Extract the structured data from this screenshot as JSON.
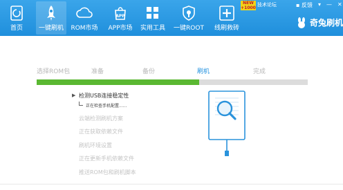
{
  "nav": {
    "home": "首页",
    "one_key_flash": "一键刷机",
    "rom_market": "ROM市场",
    "app_market": "APP市场",
    "tools": "实用工具",
    "one_key_root": "一键ROOT",
    "line_rescue": "线刷救砖"
  },
  "top_right": {
    "new_badge_text": "NEW",
    "new_badge_sub": "+1000",
    "forum": "技术论坛",
    "feedback": "反馈",
    "brand": "奇兔刷机"
  },
  "steps": [
    "选择ROM包",
    "准备",
    "备份",
    "刷机",
    "完成"
  ],
  "active_step_index": 3,
  "progress": 0.6,
  "tasks": {
    "current": "检测USB连接稳定性",
    "sub_status": "正在检查手机配置......",
    "pending": [
      "云端检测刷机方案",
      "正在获取依赖文件",
      "刷机环境设置",
      "正在更新手机依赖文件",
      "推送ROM包和刷机脚本"
    ]
  },
  "colors": {
    "topbar": "#2796e0",
    "progress_fill": "#5ab832",
    "progress_track": "#dcdcdc",
    "active_step": "#2191df"
  },
  "icons": [
    "home-icon",
    "rocket-icon",
    "cloud-icon",
    "app-icon",
    "tools-icon",
    "shield-root-icon",
    "rescue-icon",
    "bunny-logo-icon",
    "magnifier-phone-icon"
  ]
}
